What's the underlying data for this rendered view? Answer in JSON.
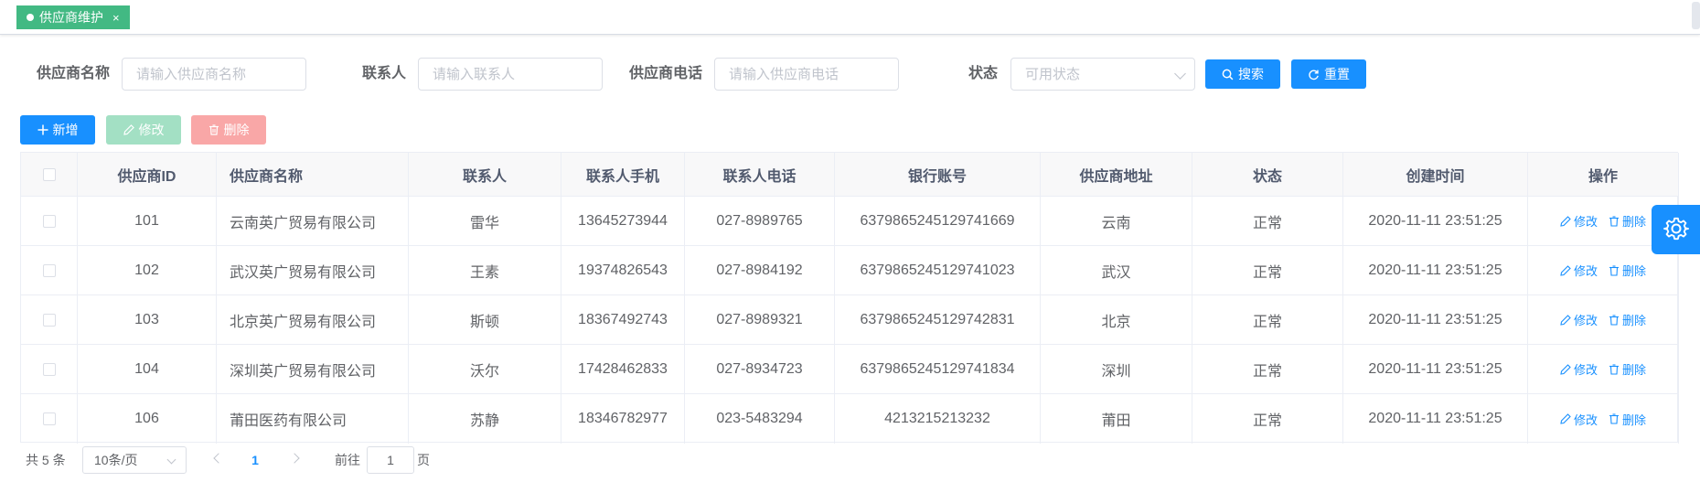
{
  "tags": {
    "active_label": "供应商维护",
    "close_glyph": "×",
    "active_color": "#42b983"
  },
  "search": {
    "name_label": "供应商名称",
    "name_placeholder": "请输入供应商名称",
    "contact_label": "联系人",
    "contact_placeholder": "请输入联系人",
    "phone_label": "供应商电话",
    "phone_placeholder": "请输入供应商电话",
    "status_label": "状态",
    "status_placeholder": "可用状态",
    "search_button": "搜索",
    "reset_button": "重置"
  },
  "toolbar": {
    "add_label": "新增",
    "edit_label": "修改",
    "delete_label": "删除"
  },
  "table": {
    "columns": [
      "供应商ID",
      "供应商名称",
      "联系人",
      "联系人手机",
      "联系人电话",
      "银行账号",
      "供应商地址",
      "状态",
      "创建时间",
      "操作"
    ],
    "rows": [
      {
        "id": "101",
        "name": "云南英广贸易有限公司",
        "contact": "雷华",
        "mobile": "13645273944",
        "phone": "027-8989765",
        "bank": "6379865245129741669",
        "address": "云南",
        "status": "正常",
        "created": "2020-11-11 23:51:25"
      },
      {
        "id": "102",
        "name": "武汉英广贸易有限公司",
        "contact": "王素",
        "mobile": "19374826543",
        "phone": "027-8984192",
        "bank": "6379865245129741023",
        "address": "武汉",
        "status": "正常",
        "created": "2020-11-11 23:51:25"
      },
      {
        "id": "103",
        "name": "北京英广贸易有限公司",
        "contact": "斯顿",
        "mobile": "18367492743",
        "phone": "027-8989321",
        "bank": "6379865245129742831",
        "address": "北京",
        "status": "正常",
        "created": "2020-11-11 23:51:25"
      },
      {
        "id": "104",
        "name": "深圳英广贸易有限公司",
        "contact": "沃尔",
        "mobile": "17428462833",
        "phone": "027-8934723",
        "bank": "6379865245129741834",
        "address": "深圳",
        "status": "正常",
        "created": "2020-11-11 23:51:25"
      },
      {
        "id": "106",
        "name": "莆田医药有限公司",
        "contact": "苏静",
        "mobile": "18346782977",
        "phone": "023-5483294",
        "bank": "4213215213232",
        "address": "莆田",
        "status": "正常",
        "created": "2020-11-11 23:51:25"
      }
    ],
    "row_edit_label": "修改",
    "row_delete_label": "删除"
  },
  "pagination": {
    "total_text": "共 5 条",
    "page_size": "10条/页",
    "current_page": "1",
    "goto_prefix": "前往",
    "goto_value": "1",
    "goto_suffix": "页"
  },
  "colors": {
    "primary": "#1890ff",
    "success_disabled": "#a3e0c4",
    "danger_disabled": "#f9a7a7"
  },
  "icons": {
    "settings": "gear-icon"
  }
}
